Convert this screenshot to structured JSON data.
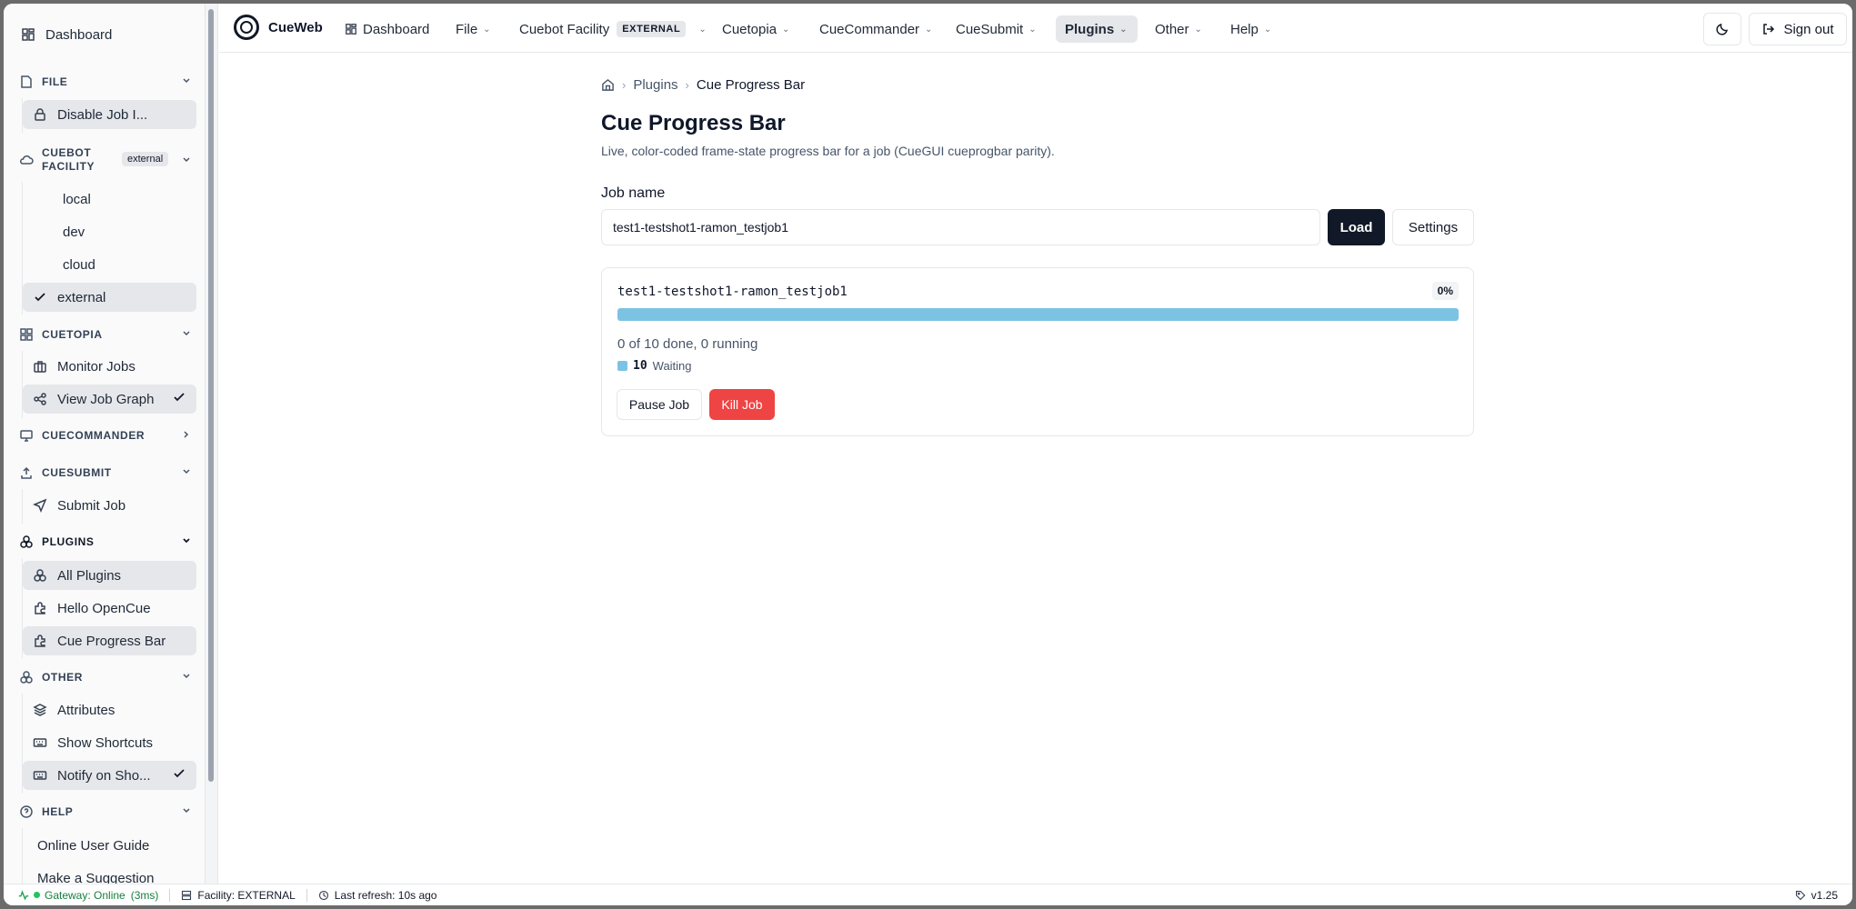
{
  "colors": {
    "accent": "#111827",
    "danger": "#ef4444",
    "waiting": "#7cc3e3",
    "online": "#22c55e"
  },
  "sidebar": {
    "dashboard": "Dashboard",
    "file": {
      "title": "FILE",
      "items": [
        "Disable Job I..."
      ]
    },
    "cuebot": {
      "title_line1": "CUEBOT",
      "title_line2": "FACILITY",
      "badge": "external",
      "items": [
        "local",
        "dev",
        "cloud",
        "external"
      ]
    },
    "cuetopia": {
      "title": "CUETOPIA",
      "items": [
        "Monitor Jobs",
        "View Job Graph"
      ]
    },
    "cuecommander": {
      "title": "CUECOMMANDER"
    },
    "cuesubmit": {
      "title": "CUESUBMIT",
      "items": [
        "Submit Job"
      ]
    },
    "plugins": {
      "title": "PLUGINS",
      "items": [
        "All Plugins",
        "Hello OpenCue",
        "Cue Progress Bar"
      ]
    },
    "other": {
      "title": "OTHER",
      "items": [
        "Attributes",
        "Show Shortcuts",
        "Notify on Sho..."
      ]
    },
    "help": {
      "title": "HELP",
      "items": [
        "Online User Guide",
        "Make a Suggestion"
      ]
    }
  },
  "topbar": {
    "app_name": "CueWeb",
    "nav": [
      "Dashboard",
      "File",
      "Cuebot Facility",
      "Cuetopia",
      "CueCommander",
      "CueSubmit",
      "Plugins",
      "Other",
      "Help"
    ],
    "facility_badge": "EXTERNAL",
    "sign_out": "Sign out",
    "theme_icon": "moon-icon"
  },
  "breadcrumb": {
    "plugins": "Plugins",
    "current": "Cue Progress Bar"
  },
  "page": {
    "title": "Cue Progress Bar",
    "description": "Live, color-coded frame-state progress bar for a job (CueGUI cueprogbar parity).",
    "job_label": "Job name",
    "job_value": "test1-testshot1-ramon_testjob1",
    "load": "Load",
    "settings": "Settings"
  },
  "job": {
    "name": "test1-testshot1-ramon_testjob1",
    "percent": "0%",
    "done_fraction": 0,
    "waiting_fraction": 1,
    "summary": "0 of 10 done, 0 running",
    "legend_count": "10",
    "legend_label": "Waiting",
    "pause": "Pause Job",
    "kill": "Kill Job"
  },
  "status": {
    "gateway": "Gateway: Online",
    "latency": "(3ms)",
    "facility": "Facility: EXTERNAL",
    "refresh": "Last refresh: 10s ago",
    "version": "v1.25"
  }
}
